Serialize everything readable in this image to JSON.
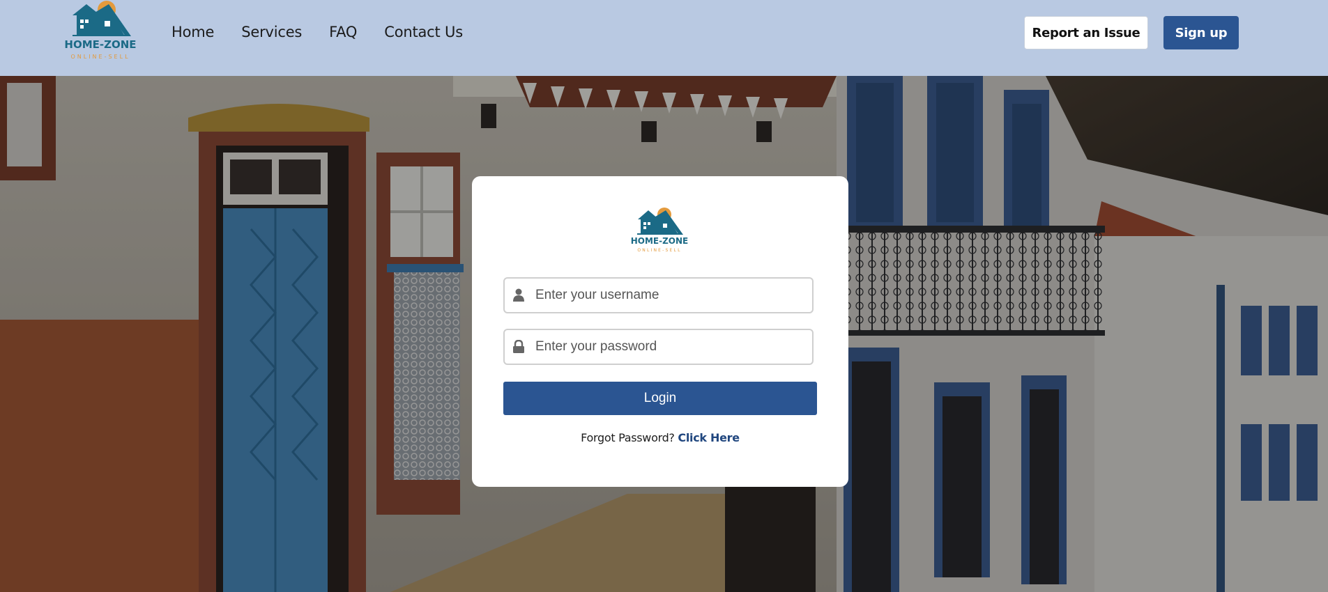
{
  "brand": {
    "name": "HOME-ZONE",
    "tagline": "ONLINE-SELL",
    "logo_icon": "house-logo-icon",
    "colors": {
      "teal": "#1b6a86",
      "orange": "#e39a3c"
    }
  },
  "nav": {
    "items": [
      {
        "label": "Home"
      },
      {
        "label": "Services"
      },
      {
        "label": "FAQ"
      },
      {
        "label": "Contact Us"
      }
    ]
  },
  "header": {
    "report_label": "Report an Issue",
    "signup_label": "Sign up"
  },
  "login": {
    "username_placeholder": "Enter your username",
    "password_placeholder": "Enter your password",
    "username_icon": "user-icon",
    "password_icon": "lock-icon",
    "submit_label": "Login",
    "forgot_text": "Forgot Password?",
    "forgot_link": "Click Here"
  },
  "colors": {
    "header_bg": "#b9c9e2",
    "primary": "#2b5592",
    "card_bg": "#ffffff"
  }
}
